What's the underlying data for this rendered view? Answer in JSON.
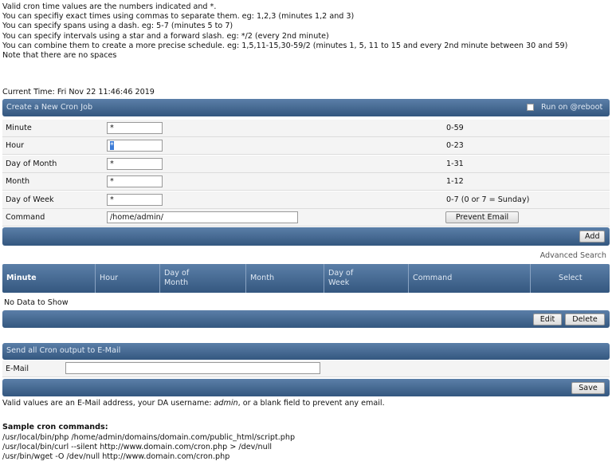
{
  "help": {
    "lines": [
      "Valid cron time values are the numbers indicated and *.",
      "You can specifiy exact times using commas to separate them. eg: 1,2,3 (minutes 1,2 and 3)",
      "You can specify spans using a dash. eg: 5-7 (minutes 5 to 7)",
      "You can specify intervals using a star and a forward slash. eg: */2 (every 2nd minute)",
      "You can combine them to create a more precise schedule. eg: 1,5,11-15,30-59/2 (minutes 1, 5, 11 to 15 and every 2nd minute between 30 and 59)",
      "Note that there are no spaces"
    ]
  },
  "current_time": "Current Time: Fri Nov 22 11:46:46 2019",
  "create": {
    "title": "Create a New Cron Job",
    "reboot_label": "Run on @reboot",
    "fields": [
      {
        "label": "Minute",
        "value": "*",
        "range": "0-59"
      },
      {
        "label": "Hour",
        "value": "*",
        "range": "0-23"
      },
      {
        "label": "Day of Month",
        "value": "*",
        "range": "1-31"
      },
      {
        "label": "Month",
        "value": "*",
        "range": "1-12"
      },
      {
        "label": "Day of Week",
        "value": "*",
        "range": "0-7 (0 or 7 = Sunday)"
      }
    ],
    "command_label": "Command",
    "command_value": "/home/admin/",
    "prevent_email": "Prevent Email",
    "add": "Add"
  },
  "advanced_search": "Advanced Search",
  "table": {
    "columns": [
      "Minute",
      "Hour",
      "Day of Month",
      "Month",
      "Day of Week",
      "Command",
      "Select"
    ],
    "empty": "No Data to Show",
    "edit": "Edit",
    "delete": "Delete"
  },
  "email": {
    "title": "Send all Cron output to E-Mail",
    "label": "E-Mail",
    "value": "",
    "save": "Save",
    "note_prefix": "Valid values are an E-Mail address, your DA username: ",
    "note_user": "admin",
    "note_suffix": ", or a blank field to prevent any email."
  },
  "samples": {
    "title": "Sample cron commands:",
    "lines": [
      "/usr/local/bin/php /home/admin/domains/domain.com/public_html/script.php",
      "/usr/local/bin/curl --silent http://www.domain.com/cron.php > /dev/null",
      "/usr/bin/wget -O /dev/null http://www.domain.com/cron.php"
    ]
  },
  "colors": {
    "bar_top": "#5b7fa8",
    "bar_bottom": "#34577f",
    "row_bg": "#f4f4f4"
  }
}
